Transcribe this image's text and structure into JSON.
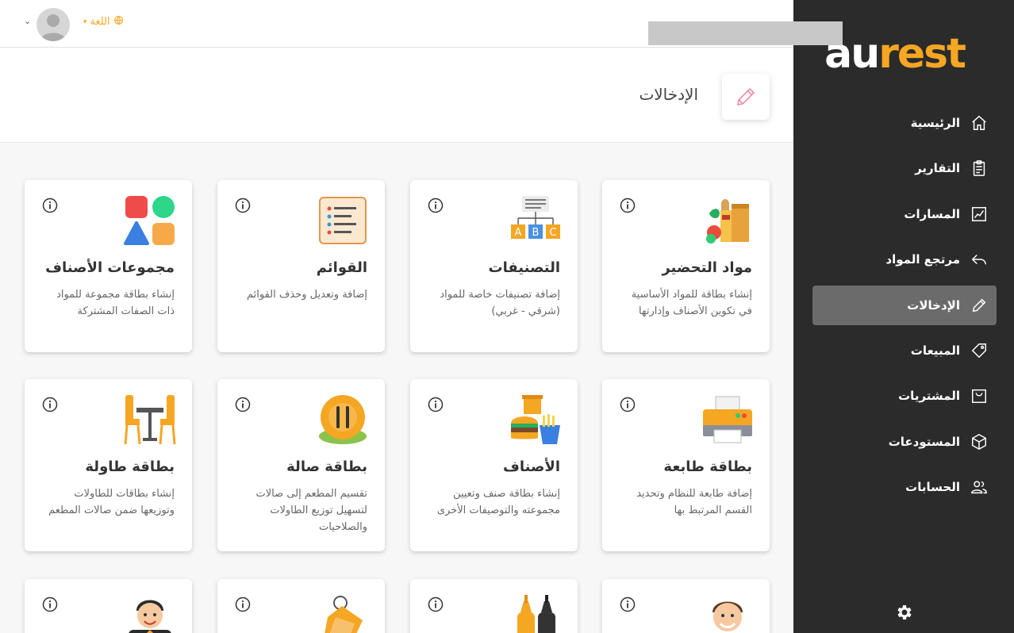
{
  "brand": {
    "logo_au": "au",
    "logo_rest": "rest",
    "accent": "#f5a623"
  },
  "topbar": {
    "language_label": "اللغة"
  },
  "sidebar": {
    "items": [
      {
        "label": "الرئيسية",
        "icon": "home-icon"
      },
      {
        "label": "التقارير",
        "icon": "clipboard-icon"
      },
      {
        "label": "المسارات",
        "icon": "chart-line-icon"
      },
      {
        "label": "مرتجع المواد",
        "icon": "reply-icon"
      },
      {
        "label": "الإدخالات",
        "icon": "pencil-icon",
        "active": true
      },
      {
        "label": "المبيعات",
        "icon": "tag-icon"
      },
      {
        "label": "المشتريات",
        "icon": "shopping-bag-icon"
      },
      {
        "label": "المستودعات",
        "icon": "box-icon"
      },
      {
        "label": "الحسابات",
        "icon": "users-icon"
      }
    ]
  },
  "page": {
    "title": "الإدخالات"
  },
  "cards": [
    {
      "title": "مواد التحضير",
      "desc": "إنشاء بطاقة للمواد الأساسية في تكوين الأصناف وإدارتها"
    },
    {
      "title": "التصنيفات",
      "desc": "إضافة تصنيفات خاصة للمواد (شرقي - غربي)"
    },
    {
      "title": "القوائم",
      "desc": "إضافة وتعديل وحذف القوائم"
    },
    {
      "title": "مجموعات الأصناف",
      "desc": "إنشاء بطاقة مجموعة للمواد ذات الصفات المشتركة"
    },
    {
      "title": "بطاقة طابعة",
      "desc": "إضافة طابعة للنظام وتحديد القسم المرتبط بها"
    },
    {
      "title": "الأصناف",
      "desc": "إنشاء بطاقة صنف وتعيين مجموعته والتوصيفات الأخرى"
    },
    {
      "title": "بطاقة صالة",
      "desc": "تقسيم المطعم إلى صالات لتسهيل توزيع الطاولات والصلاحيات"
    },
    {
      "title": "بطاقة طاولة",
      "desc": "إنشاء بطاقات للطاولات وتوزيعها ضمن صالات المطعم"
    }
  ],
  "abc_letters": [
    "A",
    "B",
    "C"
  ]
}
